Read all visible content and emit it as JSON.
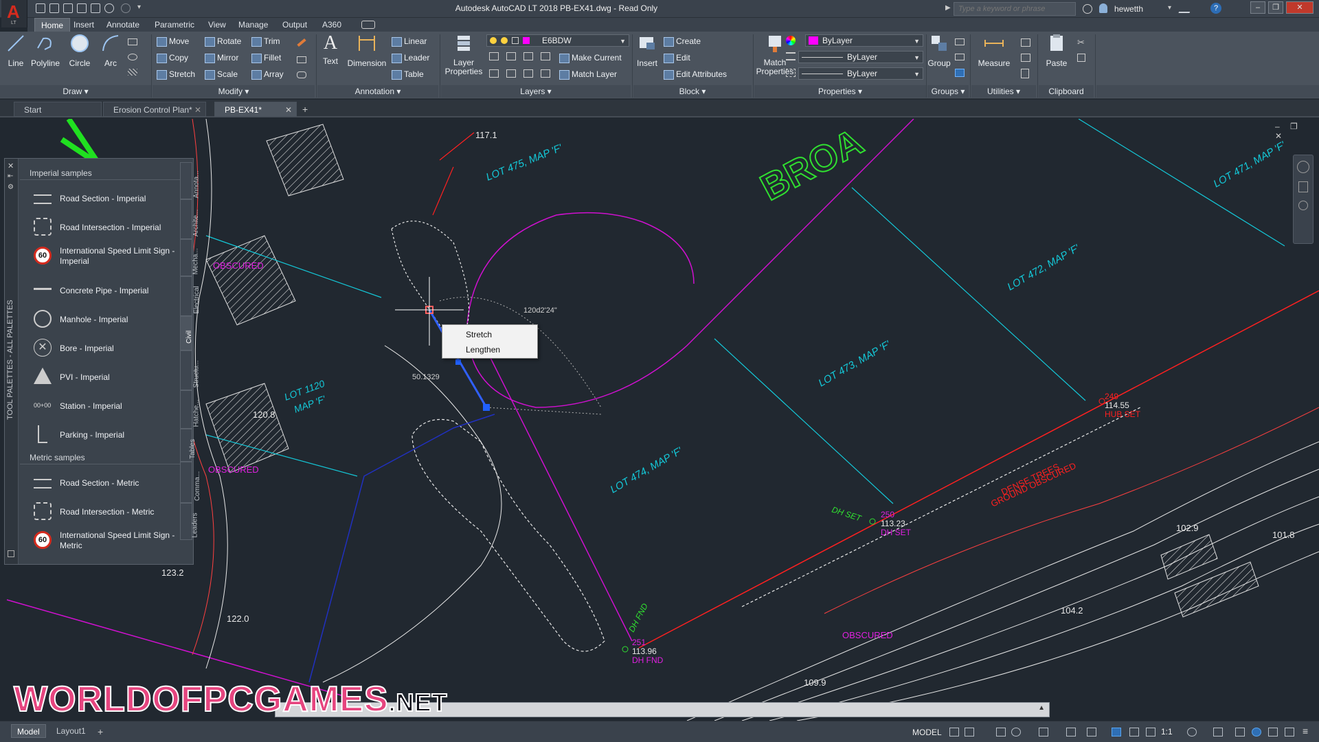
{
  "window": {
    "title": "Autodesk AutoCAD LT 2018    PB-EX41.dwg - Read Only",
    "app_logo": "A",
    "app_logo_sub": "LT",
    "search_placeholder": "Type a keyword or phrase",
    "user": "hewetth"
  },
  "ribbon_tabs": [
    "Home",
    "Insert",
    "Annotate",
    "Parametric",
    "View",
    "Manage",
    "Output",
    "A360"
  ],
  "ribbon": {
    "draw": {
      "title": "Draw",
      "buttons": [
        "Line",
        "Polyline",
        "Circle",
        "Arc"
      ]
    },
    "modify": {
      "title": "Modify",
      "items": [
        "Move",
        "Rotate",
        "Trim",
        "Copy",
        "Mirror",
        "Fillet",
        "Stretch",
        "Scale",
        "Array"
      ]
    },
    "annotation": {
      "title": "Annotation",
      "text": "Text",
      "dimension": "Dimension",
      "items": [
        "Linear",
        "Leader",
        "Table"
      ]
    },
    "layers": {
      "title": "Layers",
      "layer_properties": "Layer\nProperties",
      "current_layer": "E6BDW",
      "make_current": "Make Current",
      "match_layer": "Match Layer"
    },
    "block": {
      "title": "Block",
      "insert": "Insert",
      "create": "Create",
      "edit": "Edit",
      "edit_attributes": "Edit Attributes"
    },
    "properties": {
      "title": "Properties",
      "match": "Match\nProperties",
      "color": "ByLayer",
      "linetype": "ByLayer",
      "lineweight": "ByLayer"
    },
    "groups": {
      "title": "Groups",
      "group": "Group"
    },
    "utilities": {
      "title": "Utilities",
      "measure": "Measure"
    },
    "clipboard": {
      "title": "Clipboard",
      "paste": "Paste"
    }
  },
  "doc_tabs": [
    "Start",
    "Erosion Control Plan*",
    "PB-EX41*"
  ],
  "palette": {
    "vertical_title": "TOOL PALETTES - ALL PALETTES",
    "section_imperial": "Imperial samples",
    "imperial_items": [
      "Road Section - Imperial",
      "Road Intersection - Imperial",
      "International Speed Limit Sign - Imperial",
      "Concrete Pipe - Imperial",
      "Manhole - Imperial",
      "Bore - Imperial",
      "PVI - Imperial",
      "Station - Imperial",
      "Parking - Imperial"
    ],
    "section_metric": "Metric samples",
    "metric_items": [
      "Road Section - Metric",
      "Road Intersection - Metric",
      "International Speed Limit Sign - Metric"
    ],
    "side_tabs": [
      "Annota...",
      "Archite...",
      "Mecha...",
      "Electrical",
      "Civil",
      "Structu...",
      "Hatche...",
      "Tables",
      "Comma...",
      "Leaders"
    ],
    "speed_limit": "60",
    "station_label": "00+00"
  },
  "context_menu": [
    "Stretch",
    "Lengthen"
  ],
  "drawing_labels": {
    "broad": "BROA",
    "lot475": "LOT 475, MAP 'F'",
    "lot472": "LOT 472, MAP 'F'",
    "lot471": "LOT 471, MAP 'F'",
    "lot473": "LOT 473, MAP 'F'",
    "lot474": "LOT 474, MAP 'F'",
    "lot1120": "LOT 1120",
    "lot1120b": "MAP 'F'",
    "obscured": "OBSCURED",
    "angle": "120d2'24\"",
    "length": "50.1329",
    "elev1171": "117.1",
    "elev1208": "120.8",
    "elev1232": "123.2",
    "elev1220": "122.0",
    "elev1029": "102.9",
    "elev1018": "101.8",
    "elev1042": "104.2",
    "elev1099": "109.9",
    "pt249": "249",
    "pt249v": "114.55",
    "hub_set": "HUB SET",
    "pt250": "250",
    "pt250v": "113.23",
    "dh_set": "DH SET",
    "pt251": "251",
    "pt251v": "113.96",
    "dh_fnd": "DH FND",
    "dense_trees": "DENSE TREES",
    "ground_obscured": "GROUND OBSCURED"
  },
  "statusbar": {
    "tabs": [
      "Model",
      "Layout1"
    ],
    "model_label": "MODEL",
    "scale": "1:1"
  },
  "watermark": {
    "main": "WORLDOFPCGAMES",
    "suffix": ".NET"
  }
}
